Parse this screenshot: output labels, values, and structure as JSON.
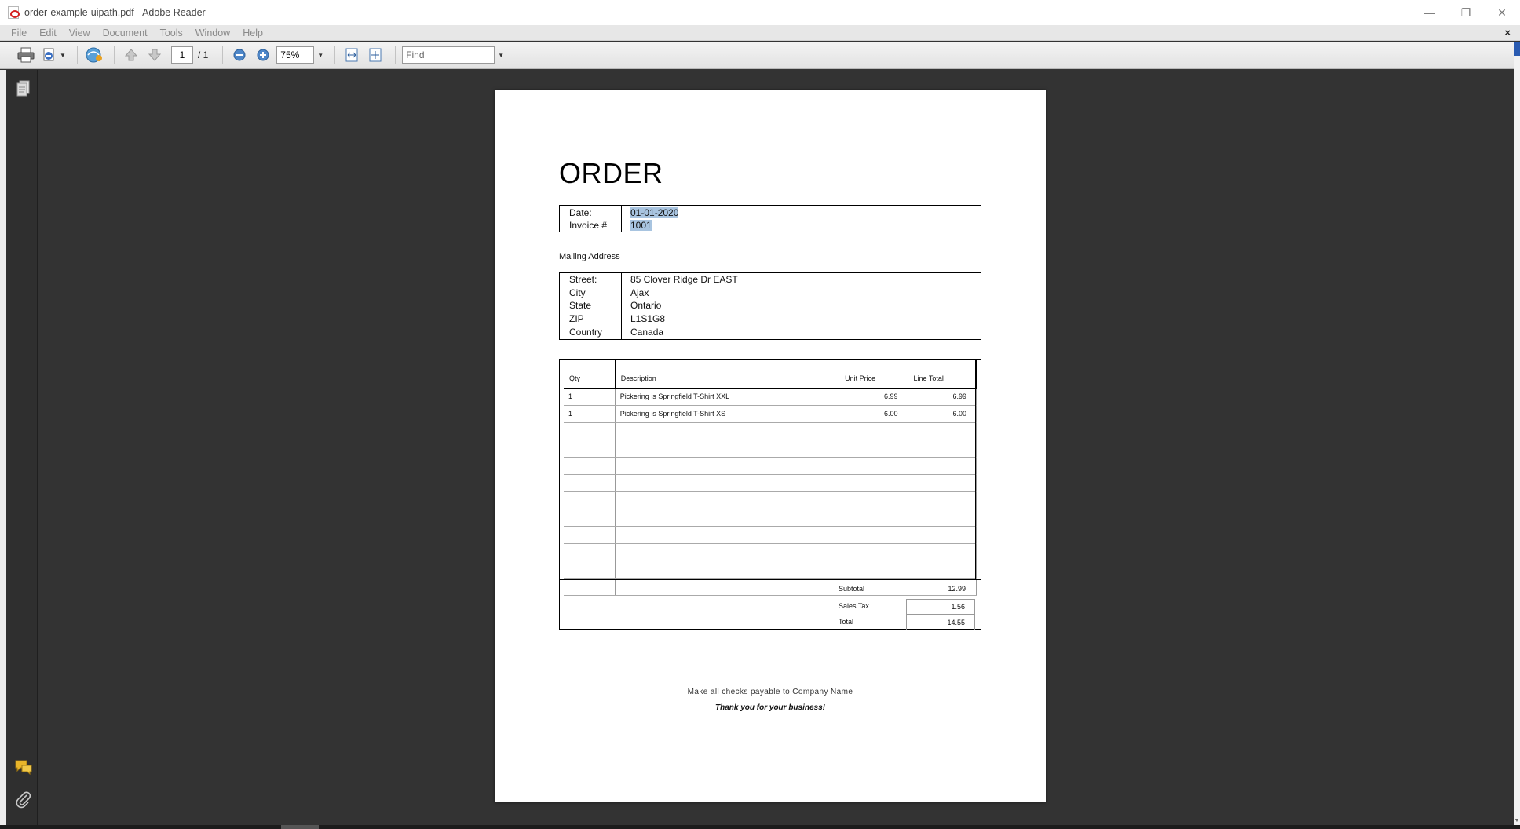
{
  "window": {
    "title": "order-example-uipath.pdf - Adobe Reader",
    "minimize": "—",
    "restore": "❐",
    "close": "✕"
  },
  "menu": {
    "items": [
      "File",
      "Edit",
      "View",
      "Document",
      "Tools",
      "Window",
      "Help"
    ],
    "close_doc": "×"
  },
  "toolbar": {
    "page_current": "1",
    "page_total": "/ 1",
    "zoom": "75%",
    "find_placeholder": "Find"
  },
  "document": {
    "heading": "ORDER",
    "date_label": "Date:",
    "date_value": "01-01-2020",
    "invoice_label": "Invoice #",
    "invoice_value": "1001",
    "mailing_label": "Mailing Address",
    "address": [
      {
        "label": "Street:",
        "value": "85 Clover Ridge Dr EAST"
      },
      {
        "label": "City",
        "value": "Ajax"
      },
      {
        "label": "State",
        "value": "Ontario"
      },
      {
        "label": "ZIP",
        "value": "L1S1G8"
      },
      {
        "label": "Country",
        "value": "Canada"
      }
    ],
    "columns": [
      "Qty",
      "Description",
      "Unit Price",
      "Line Total"
    ],
    "rows": [
      [
        "1",
        "Pickering is Springfield T-Shirt XXL",
        "6.99",
        "6.99"
      ],
      [
        "1",
        "Pickering is Springfield T-Shirt XS",
        "6.00",
        "6.00"
      ],
      [
        "",
        "",
        "",
        ""
      ],
      [
        "",
        "",
        "",
        ""
      ],
      [
        "",
        "",
        "",
        ""
      ],
      [
        "",
        "",
        "",
        ""
      ],
      [
        "",
        "",
        "",
        ""
      ],
      [
        "",
        "",
        "",
        ""
      ],
      [
        "",
        "",
        "",
        ""
      ],
      [
        "",
        "",
        "",
        ""
      ],
      [
        "",
        "",
        "",
        ""
      ],
      [
        "",
        "",
        "",
        ""
      ]
    ],
    "subtotal_label": "Subtotal",
    "subtotal_value": "12.99",
    "tax_label": "Sales Tax",
    "tax_value": "1.56",
    "total_label": "Total",
    "total_value": "14.55",
    "footer_checks": "Make all checks payable to Company Name",
    "footer_thanks": "Thank you for your business!"
  }
}
